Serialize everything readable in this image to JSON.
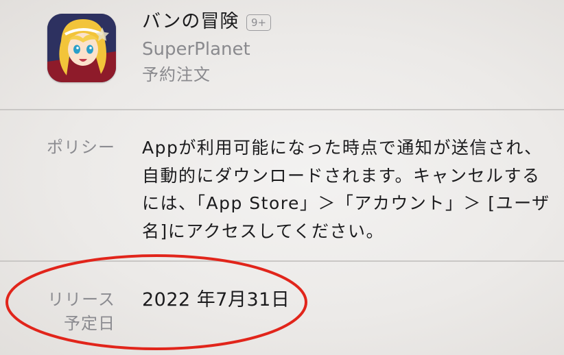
{
  "app": {
    "name": "バンの冒険",
    "age_rating": "9+",
    "developer": "SuperPlanet",
    "status": "予約注文"
  },
  "policy": {
    "label": "ポリシー",
    "text": "Appが利用可能になった時点で通知が送信され、自動的にダウンロードされます。キャンセルするには、「App Store」＞「アカウント」＞ [ユーザ名]にアクセスしてください。"
  },
  "release": {
    "label_line1": "リリース",
    "label_line2": "予定日",
    "date": "2022 年7月31日"
  },
  "colors": {
    "annotation_circle": "#e1251b",
    "secondary_text": "#8a8a8e",
    "primary_text": "#1b1b1d"
  },
  "icons": {
    "app_icon": "anime-character-app-icon"
  }
}
